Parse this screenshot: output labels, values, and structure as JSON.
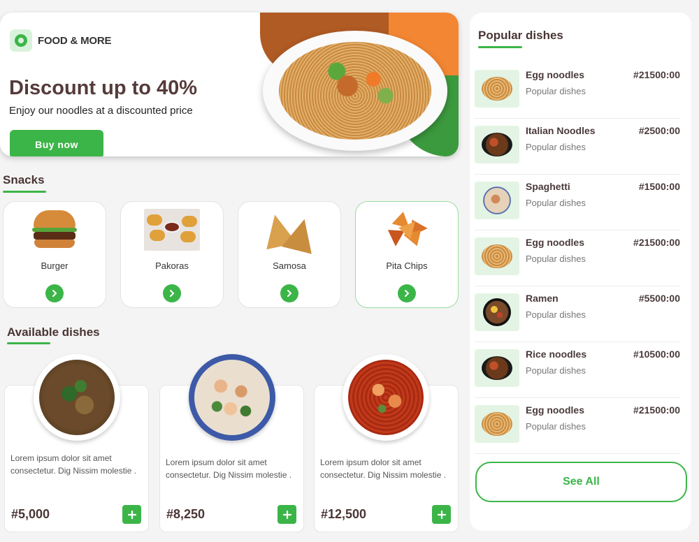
{
  "brand": {
    "name": "FOOD & MORE"
  },
  "hero": {
    "headline": "Discount up to 40%",
    "subtext": "Enjoy our noodles at a discounted price",
    "cta_label": "Buy now"
  },
  "snacks": {
    "title": "Snacks",
    "items": [
      {
        "label": "Burger",
        "icon": "burger-image"
      },
      {
        "label": "Pakoras",
        "icon": "pakoras-image"
      },
      {
        "label": "Samosa",
        "icon": "samosa-image"
      },
      {
        "label": "Pita Chips",
        "icon": "pita-chips-image"
      }
    ]
  },
  "available": {
    "title": "Available dishes",
    "items": [
      {
        "description": "Lorem ipsum dolor sit amet consectetur. Dig Nissim molestie .",
        "price": "#5,000"
      },
      {
        "description": "Lorem ipsum dolor sit amet consectetur. Dig Nissim molestie .",
        "price": "#8,250"
      },
      {
        "description": "Lorem ipsum dolor sit amet consectetur. Dig Nissim molestie .",
        "price": "#12,500"
      }
    ]
  },
  "popular": {
    "title": "Popular dishes",
    "items": [
      {
        "name": "Egg noodles",
        "category": "Popular dishes",
        "price": "#21500:00"
      },
      {
        "name": "Italian Noodles",
        "category": "Popular dishes",
        "price": "#2500:00"
      },
      {
        "name": "Spaghetti",
        "category": "Popular dishes",
        "price": "#1500:00"
      },
      {
        "name": "Egg noodles",
        "category": "Popular dishes",
        "price": "#21500:00"
      },
      {
        "name": "Ramen",
        "category": "Popular dishes",
        "price": "#5500:00"
      },
      {
        "name": "Rice noodles",
        "category": "Popular dishes",
        "price": "#10500:00"
      },
      {
        "name": "Egg noodles",
        "category": "Popular dishes",
        "price": "#21500:00"
      }
    ],
    "see_all_label": "See All"
  },
  "colors": {
    "accent": "#3cb548",
    "heading": "#4a3535",
    "orange": "#f28633",
    "brown": "#b05a24",
    "green_dark": "#3c9a3e"
  }
}
